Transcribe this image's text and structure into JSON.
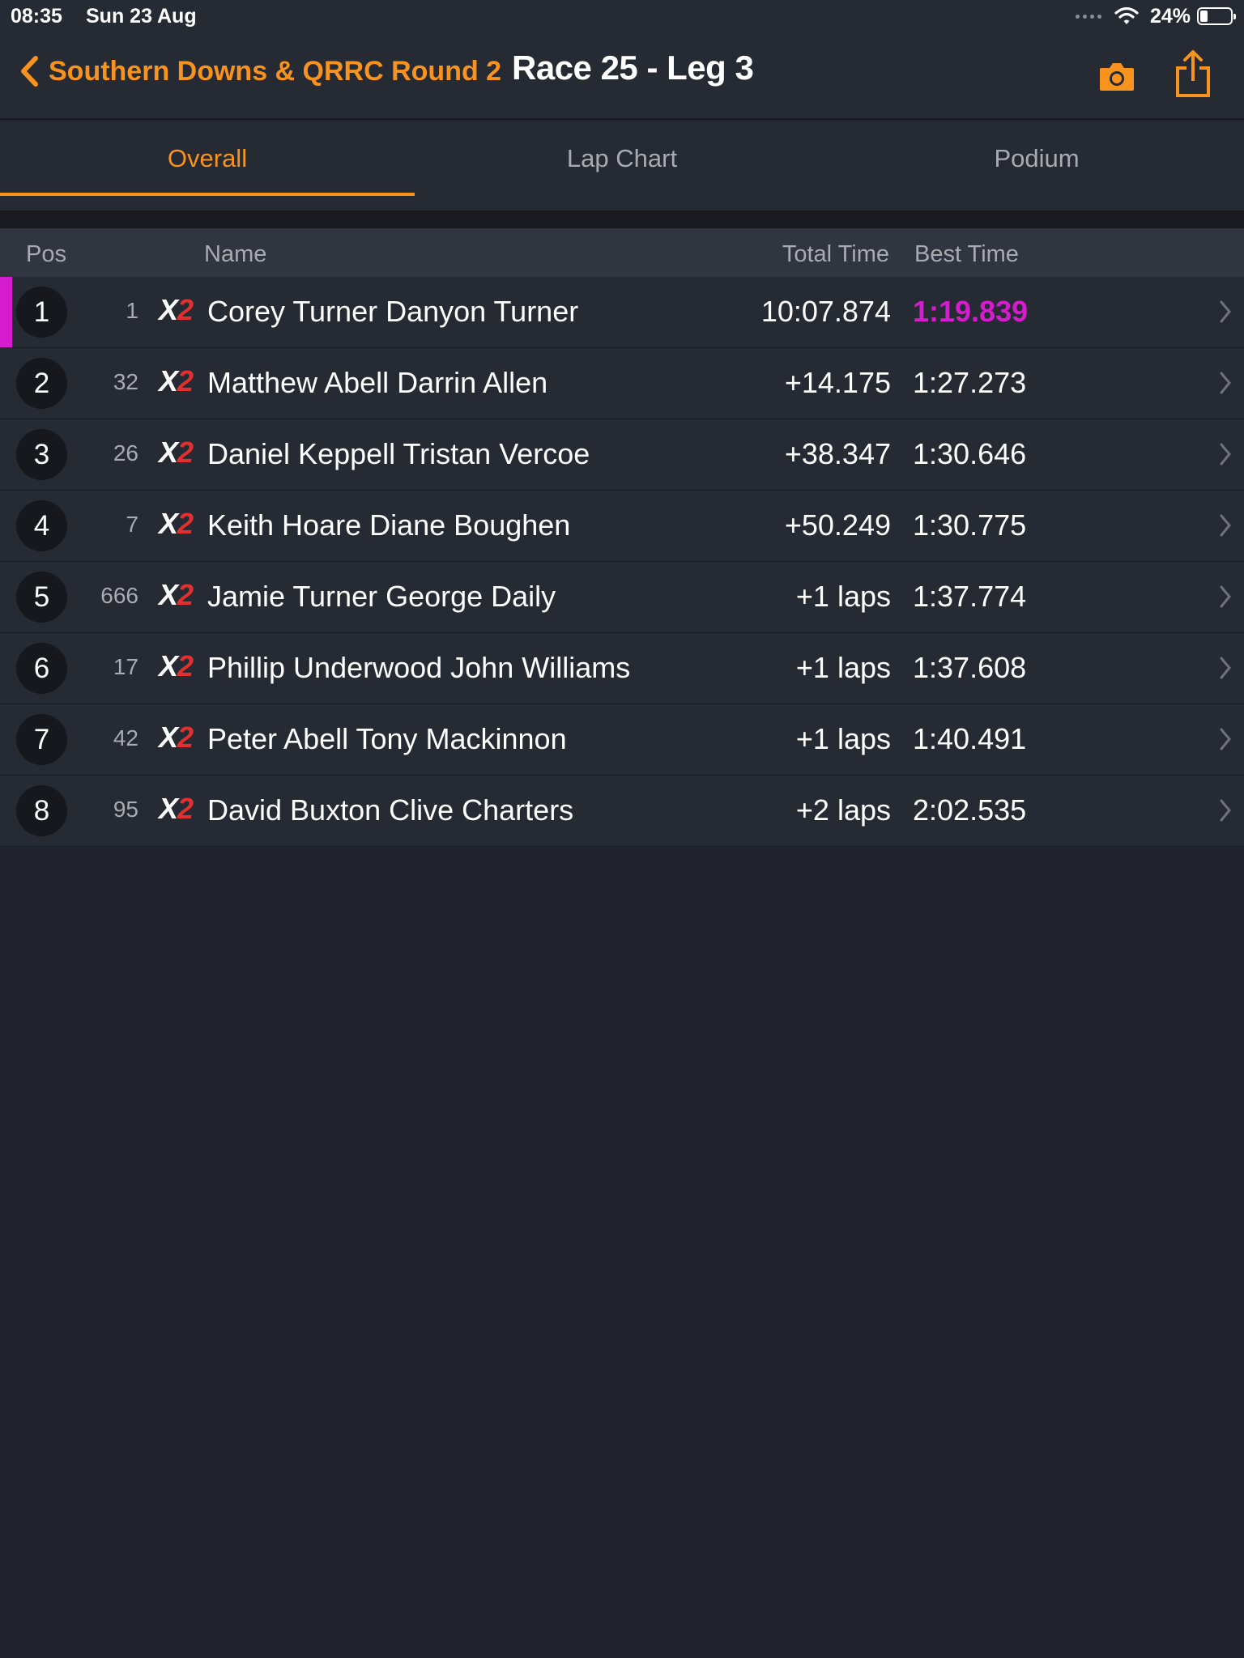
{
  "status_bar": {
    "time": "08:35",
    "date": "Sun 23 Aug",
    "battery_pct": "24%",
    "battery_level": 0.24
  },
  "nav": {
    "back_label": "Southern Downs & QRRC Round 2",
    "title": "Race 25 - Leg 3"
  },
  "tabs": [
    {
      "label": "Overall",
      "active": true
    },
    {
      "label": "Lap Chart",
      "active": false
    },
    {
      "label": "Podium",
      "active": false
    }
  ],
  "table": {
    "headers": {
      "pos": "Pos",
      "name": "Name",
      "total": "Total Time",
      "best": "Best Time"
    },
    "class_badge": {
      "x": "X",
      "two": "2"
    },
    "rows": [
      {
        "pos": "1",
        "num": "1",
        "name": "Corey Turner Danyon Turner",
        "total": "10:07.874",
        "best": "1:19.839",
        "fastest": true
      },
      {
        "pos": "2",
        "num": "32",
        "name": "Matthew Abell Darrin Allen",
        "total": "+14.175",
        "best": "1:27.273",
        "fastest": false
      },
      {
        "pos": "3",
        "num": "26",
        "name": "Daniel Keppell Tristan Vercoe",
        "total": "+38.347",
        "best": "1:30.646",
        "fastest": false
      },
      {
        "pos": "4",
        "num": "7",
        "name": "Keith Hoare Diane Boughen",
        "total": "+50.249",
        "best": "1:30.775",
        "fastest": false
      },
      {
        "pos": "5",
        "num": "666",
        "name": "Jamie Turner George Daily",
        "total": "+1 laps",
        "best": "1:37.774",
        "fastest": false
      },
      {
        "pos": "6",
        "num": "17",
        "name": "Phillip Underwood John Williams",
        "total": "+1 laps",
        "best": "1:37.608",
        "fastest": false
      },
      {
        "pos": "7",
        "num": "42",
        "name": "Peter Abell Tony Mackinnon",
        "total": "+1 laps",
        "best": "1:40.491",
        "fastest": false
      },
      {
        "pos": "8",
        "num": "95",
        "name": "David Buxton Clive Charters",
        "total": "+2 laps",
        "best": "2:02.535",
        "fastest": false
      }
    ]
  },
  "colors": {
    "accent": "#f7931e",
    "fastest": "#d61ccf",
    "background": "#21242c",
    "badge_red": "#e03030"
  },
  "icons": {
    "back": "chevron-left-icon",
    "camera": "camera-icon",
    "share": "share-icon",
    "row": "chevron-right-icon",
    "wifi": "wifi-icon",
    "battery": "battery-icon"
  }
}
